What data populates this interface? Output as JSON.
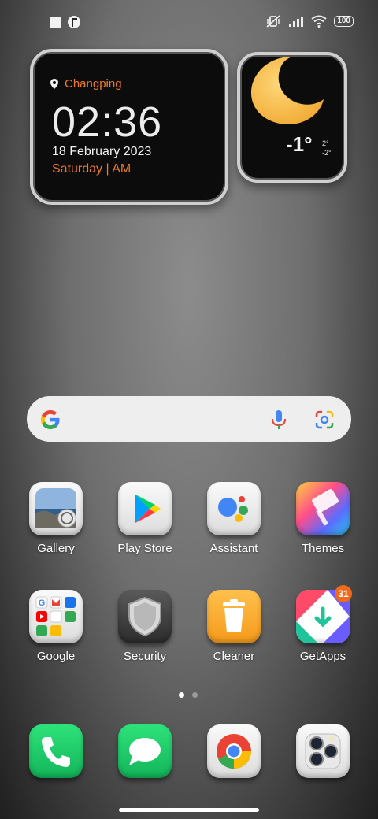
{
  "status_bar": {
    "battery": "100"
  },
  "clock_widget": {
    "location": "Changping",
    "time": "02:36",
    "date": "18 February 2023",
    "day": "Saturday | AM"
  },
  "weather_widget": {
    "temperature": "-1°",
    "high": "2°",
    "low": "-2°"
  },
  "apps_row1": [
    {
      "label": "Gallery"
    },
    {
      "label": "Play Store"
    },
    {
      "label": "Assistant"
    },
    {
      "label": "Themes"
    }
  ],
  "apps_row2": [
    {
      "label": "Google"
    },
    {
      "label": "Security"
    },
    {
      "label": "Cleaner"
    },
    {
      "label": "GetApps",
      "badge": "31"
    }
  ],
  "page_indicator": {
    "current": 1,
    "total": 2
  },
  "dock": [
    {
      "icon": "phone-icon"
    },
    {
      "icon": "messages-icon"
    },
    {
      "icon": "chrome-icon"
    },
    {
      "icon": "camera-icon"
    }
  ]
}
